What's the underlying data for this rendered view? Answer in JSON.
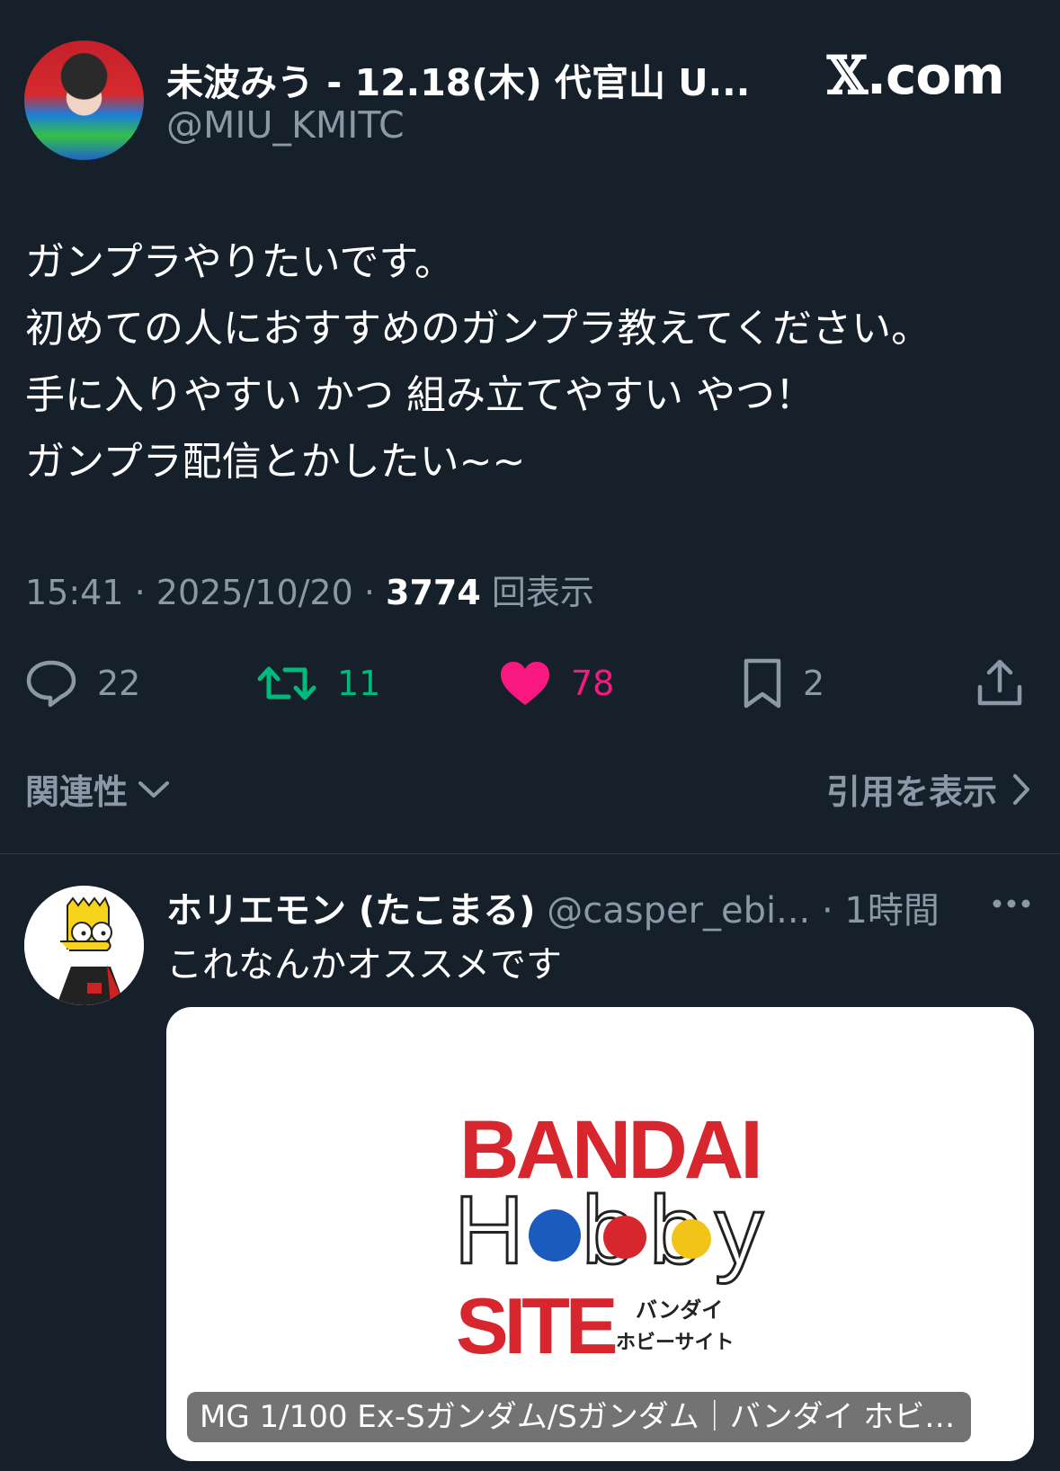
{
  "author": {
    "name": "未波みう - 12.18(木) 代官山 U...",
    "handle": "@MIU_KMITC"
  },
  "site_logo": "X.com",
  "tweet": {
    "lines": [
      "ガンプラやりたいです。",
      "初めての人におすすめのガンプラ教えてください。",
      "手に入りやすい かつ 組み立てやすい やつ！",
      "ガンプラ配信とかしたい~~"
    ],
    "time": "15:41",
    "date": "2025/10/20",
    "views_count": "3774",
    "views_label": "回表示"
  },
  "actions": {
    "replies": "22",
    "retweets": "11",
    "likes": "78",
    "bookmarks": "2",
    "retweet_color": "#00ba7c",
    "like_color": "#f91880"
  },
  "sort": {
    "relevance_label": "関連性",
    "quotes_label": "引用を表示"
  },
  "reply": {
    "name": "ホリエモン (たこまる)",
    "handle": "@casper_ebi...",
    "time": "1時間",
    "text": "これなんかオススメです",
    "card": {
      "logo_text": "BANDAI Hobby SITE バンダイ ホビーサイト",
      "title": "MG 1/100 Ex-Sガンダム/Sガンダム｜バンダイ ホビ…"
    }
  }
}
